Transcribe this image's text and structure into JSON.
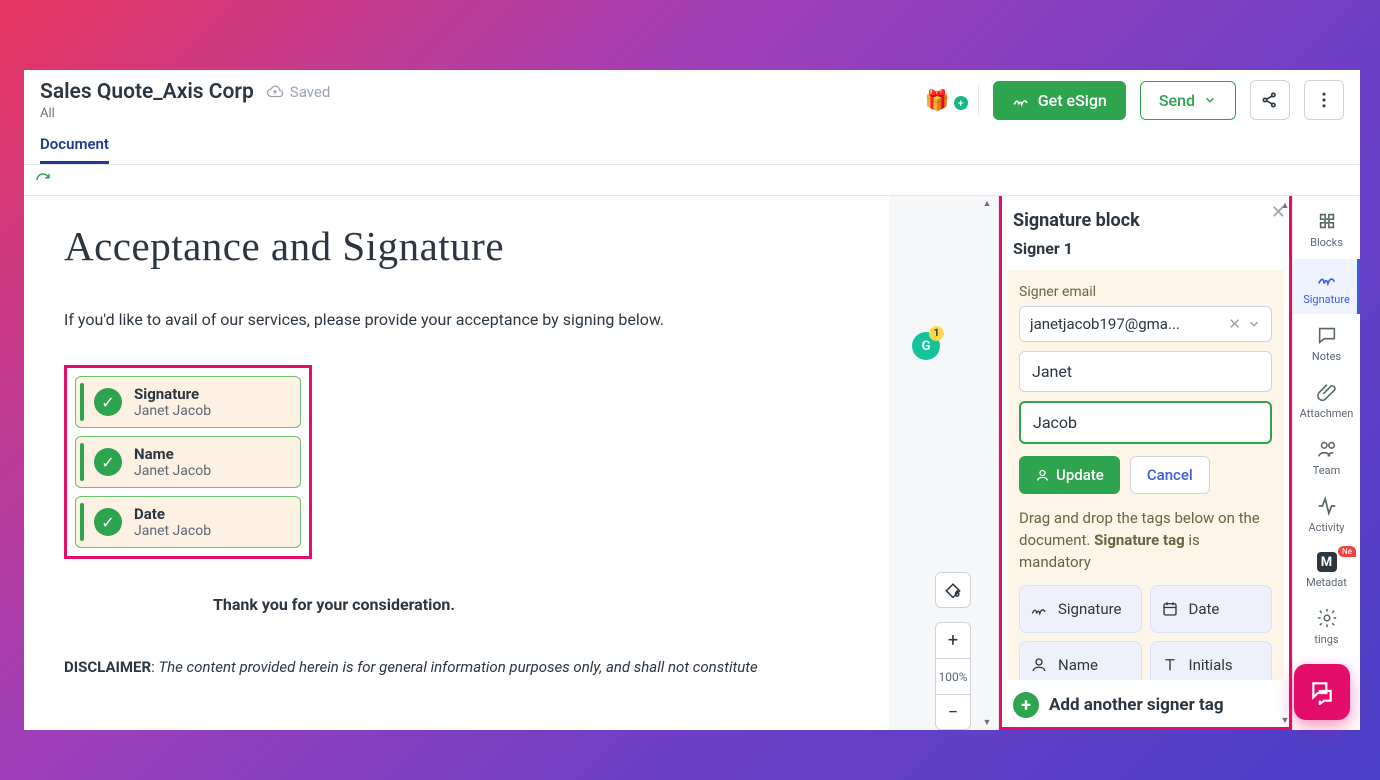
{
  "header": {
    "title": "Sales Quote_Axis Corp",
    "saved_label": "Saved",
    "workspace": "All"
  },
  "top_actions": {
    "get_esign": "Get eSign",
    "send": "Send"
  },
  "tab": {
    "document": "Document"
  },
  "doc": {
    "h1": "Acceptance and Signature",
    "intro": "If you'd like to avail of our services, please provide your acceptance by signing below.",
    "blocks": [
      {
        "label": "Signature",
        "name": "Janet Jacob"
      },
      {
        "label": "Name",
        "name": "Janet Jacob"
      },
      {
        "label": "Date",
        "name": "Janet Jacob"
      }
    ],
    "thanks": "Thank you for your consideration.",
    "disclaimer_lead": "DISCLAIMER",
    "disclaimer_body": "The content provided herein is for general information purposes only, and shall not constitute"
  },
  "zoom": {
    "level": "100%"
  },
  "panel": {
    "title": "Signature block",
    "signer_heading": "Signer 1",
    "email_label": "Signer email",
    "email_value": "janetjacob197@gma...",
    "first_name": "Janet",
    "last_name": "Jacob",
    "update": "Update",
    "cancel": "Cancel",
    "hint_prefix": "Drag and drop the tags below on the document. ",
    "hint_strong": "Signature tag",
    "hint_suffix": " is mandatory",
    "tags": {
      "signature": "Signature",
      "date": "Date",
      "name": "Name",
      "initials": "Initials"
    },
    "add_signer": "Add another signer tag"
  },
  "rail": {
    "blocks": "Blocks",
    "signature": "Signature",
    "notes": "Notes",
    "attachments": "Attachmen",
    "team": "Team",
    "activity": "Activity",
    "metadata": "Metadat",
    "settings": "tings",
    "new_badge": "Ne"
  }
}
